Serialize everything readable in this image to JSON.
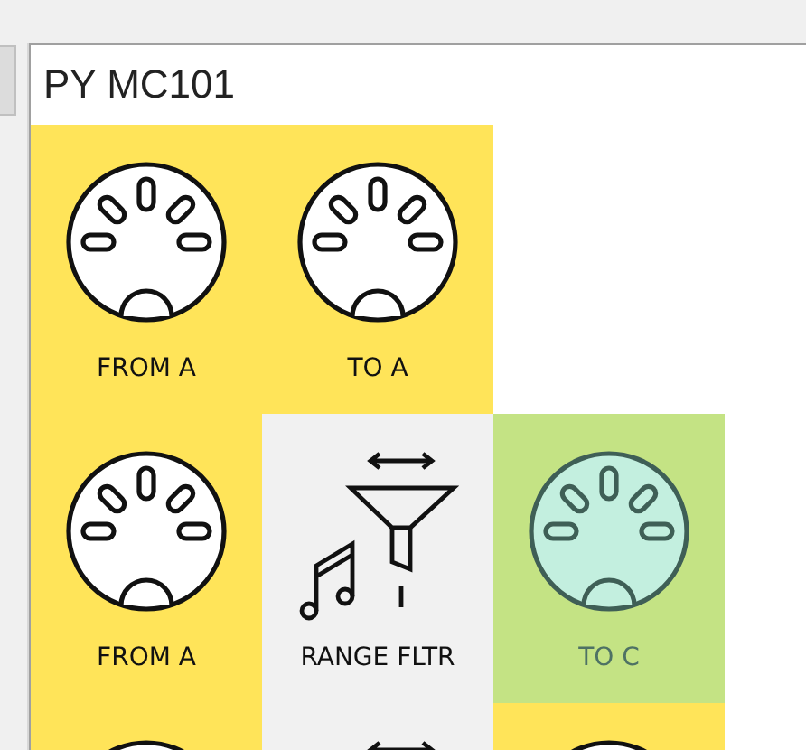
{
  "title": "PY MC101",
  "rows": [
    {
      "tiles": [
        {
          "kind": "port",
          "label": "FROM A",
          "color": "#ffe459",
          "selected": false
        },
        {
          "kind": "port",
          "label": "TO A",
          "color": "#ffe459",
          "selected": false
        }
      ]
    },
    {
      "tiles": [
        {
          "kind": "port",
          "label": "FROM A",
          "color": "#ffe459",
          "selected": false
        },
        {
          "kind": "filter",
          "label": "RANGE FLTR",
          "color": "#f1f1f1",
          "selected": false
        },
        {
          "kind": "port",
          "label": "TO C",
          "color": "#c4e384",
          "selected": true
        }
      ]
    },
    {
      "tiles": [
        {
          "kind": "port",
          "color": "#ffe459",
          "selected": false
        },
        {
          "kind": "filter",
          "color": "#f1f1f1",
          "selected": false
        },
        {
          "kind": "port",
          "color": "#ffe459",
          "selected": false
        }
      ]
    }
  ]
}
